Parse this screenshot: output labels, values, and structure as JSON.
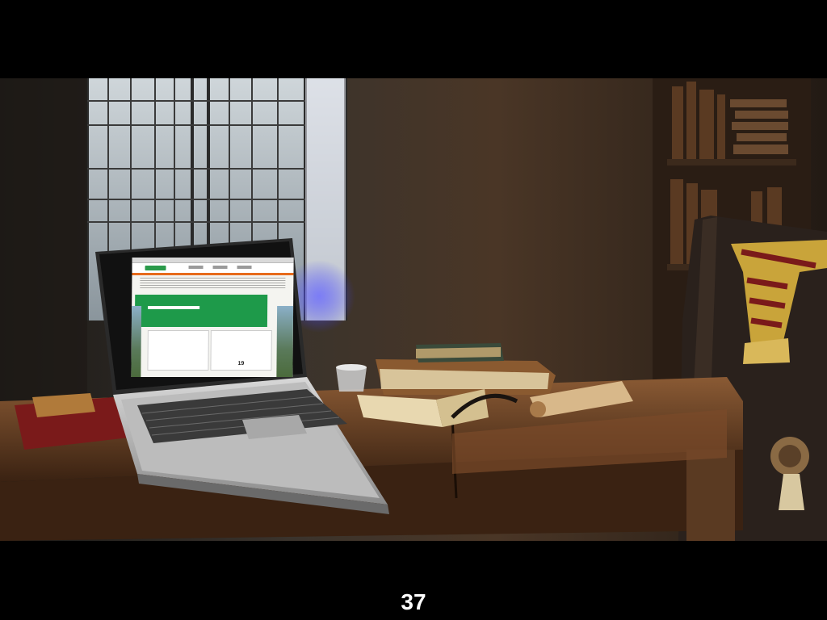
{
  "slide": {
    "page_number": "37"
  },
  "scene": {
    "description_icons": [
      "laptop-icon",
      "book-stack-icon",
      "scroll-icon",
      "inkwell-icon",
      "scarf-icon",
      "chair-icon",
      "bookshelf-icon",
      "window-icon"
    ]
  },
  "laptop_screen": {
    "badge": "19"
  },
  "colors": {
    "screen_green": "#1e9a4a",
    "screen_orange": "#e76b1c",
    "scarf_gold": "#c9a43a",
    "scarf_red": "#7a1a1a"
  }
}
